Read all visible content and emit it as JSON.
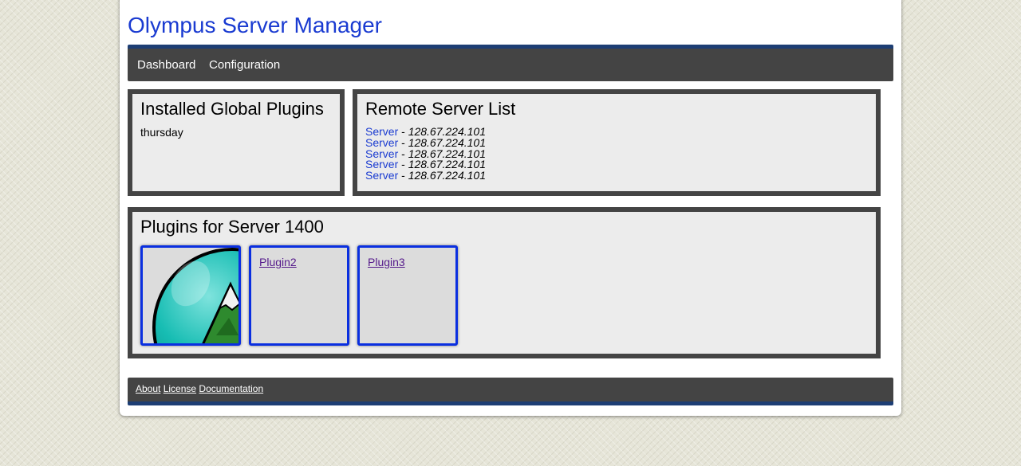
{
  "header": {
    "title": "Olympus Server Manager"
  },
  "nav": {
    "items": [
      "Dashboard",
      "Configuration"
    ]
  },
  "global_plugins": {
    "title": "Installed Global Plugins",
    "items": [
      "thursday"
    ]
  },
  "remote_servers": {
    "title": "Remote Server List",
    "servers": [
      {
        "label": "Server",
        "separator": "-",
        "ip": "128.67.224.101"
      },
      {
        "label": "Server",
        "separator": "-",
        "ip": "128.67.224.101"
      },
      {
        "label": "Server",
        "separator": "-",
        "ip": "128.67.224.101"
      },
      {
        "label": "Server",
        "separator": "-",
        "ip": "128.67.224.101"
      },
      {
        "label": "Server",
        "separator": "-",
        "ip": "128.67.224.101"
      }
    ]
  },
  "server_plugins": {
    "title": "Plugins for Server 1400",
    "tiles": [
      {
        "label": "",
        "icon": "mountain-logo-icon"
      },
      {
        "label": "Plugin2"
      },
      {
        "label": "Plugin3"
      }
    ]
  },
  "footer": {
    "links": [
      "About",
      "License",
      "Documentation"
    ]
  },
  "colors": {
    "accent": "#1a3bd1",
    "bar": "#444444",
    "bar_stripe": "#1d3e74",
    "tile_border": "#0a2fe0"
  }
}
